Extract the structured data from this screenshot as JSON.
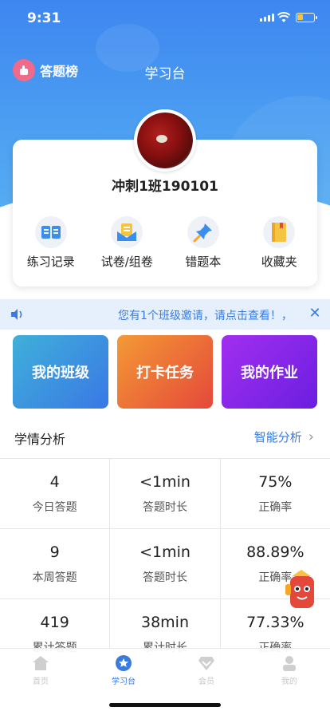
{
  "status_bar": {
    "time": "9:31"
  },
  "nav": {
    "leaderboard_label": "答题榜",
    "title": "学习台"
  },
  "profile": {
    "username": "冲刺1班190101"
  },
  "quick_actions": [
    {
      "label": "练习记录",
      "icon": "open-book-icon"
    },
    {
      "label": "试卷/组卷",
      "icon": "paper-envelope-icon"
    },
    {
      "label": "错题本",
      "icon": "pushpin-icon"
    },
    {
      "label": "收藏夹",
      "icon": "folder-book-icon"
    }
  ],
  "notice": {
    "text": "您有1个班级邀请，请点击查看！，"
  },
  "tiles": [
    {
      "label": "我的班级"
    },
    {
      "label": "打卡任务"
    },
    {
      "label": "我的作业"
    }
  ],
  "analysis": {
    "title": "学情分析",
    "link_label": "智能分析",
    "rows": [
      [
        {
          "value": "4",
          "label": "今日答题"
        },
        {
          "value": "<1min",
          "label": "答题时长"
        },
        {
          "value": "75%",
          "label": "正确率"
        }
      ],
      [
        {
          "value": "9",
          "label": "本周答题"
        },
        {
          "value": "<1min",
          "label": "答题时长"
        },
        {
          "value": "88.89%",
          "label": "正确率"
        }
      ],
      [
        {
          "value": "419",
          "label": "累计答题"
        },
        {
          "value": "38min",
          "label": "累计时长"
        },
        {
          "value": "77.33%",
          "label": "正确率"
        }
      ]
    ]
  },
  "tabbar": [
    {
      "label": "首页",
      "icon": "home-icon",
      "active": false
    },
    {
      "label": "学习台",
      "icon": "star-circle-icon",
      "active": true
    },
    {
      "label": "会员",
      "icon": "diamond-icon",
      "active": false
    },
    {
      "label": "我的",
      "icon": "person-icon",
      "active": false
    }
  ],
  "colors": {
    "accent": "#3a7be0",
    "header_top": "#3d86f0",
    "notice_bg": "#e6f0fd"
  }
}
